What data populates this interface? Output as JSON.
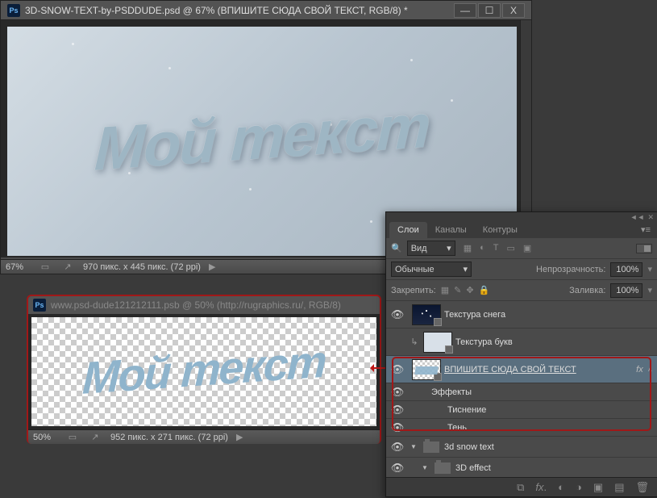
{
  "main_doc": {
    "title": "3D-SNOW-TEXT-by-PSDDUDE.psd @ 67% (ВПИШИТЕ СЮДА СВОЙ ТЕКСТ, RGB/8) *",
    "canvas_text": "Мой текст",
    "zoom": "67%",
    "dimensions": "970 пикс. x 445 пикс. (72 ppi)"
  },
  "second_doc": {
    "title": "www.psd-dude121212111.psb @ 50% (http://rugraphics.ru/, RGB/8)",
    "canvas_text": "Мой текст",
    "zoom": "50%",
    "dimensions": "952 пикс. x 271 пикс. (72 ppi)"
  },
  "layers_panel": {
    "tabs": [
      "Слои",
      "Каналы",
      "Контуры"
    ],
    "filter_label": "Вид",
    "blend_mode": "Обычные",
    "opacity_label": "Непрозрачность:",
    "opacity_value": "100%",
    "lock_label": "Закрепить:",
    "fill_label": "Заливка:",
    "fill_value": "100%",
    "layers": [
      {
        "name": "Текстура снега"
      },
      {
        "name": "Текстура букв"
      },
      {
        "name": "ВПИШИТЕ СЮДА СВОЙ ТЕКСТ ",
        "fx": "fx",
        "effects_label": "Эффекты",
        "sub": [
          "Тиснение",
          "Тень"
        ]
      },
      {
        "name": "3d snow text"
      },
      {
        "name": "3D effect"
      }
    ]
  },
  "win_buttons": {
    "min": "—",
    "max": "☐",
    "close": "X"
  },
  "chart_data": null
}
